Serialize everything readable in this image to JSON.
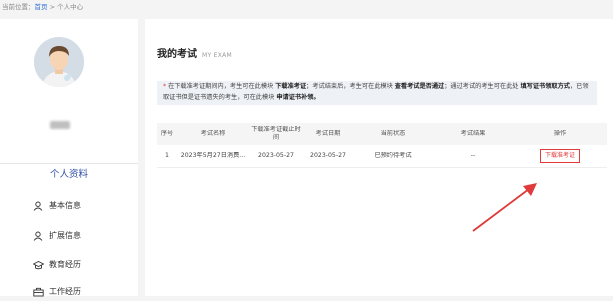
{
  "breadcrumb": {
    "prefix": "当前位置：",
    "home": "首页",
    "sep": " > ",
    "current": "个人中心"
  },
  "sidebar": {
    "section_title": "个人资料",
    "items": [
      {
        "label": "基本信息",
        "icon": "person-icon"
      },
      {
        "label": "扩展信息",
        "icon": "person-icon"
      },
      {
        "label": "教育经历",
        "icon": "graduation-cap-icon"
      },
      {
        "label": "工作经历",
        "icon": "briefcase-icon"
      }
    ]
  },
  "main": {
    "title": "我的考试",
    "title_sub": "MY EXAM",
    "notice": {
      "star": "*",
      "p1": "在下载准考证期间内，考生可在此模块 ",
      "b1": "下载准考证",
      "p2": "；考试结束后，考生可在此模块 ",
      "b2": "查看考试是否通过",
      "p3": "；通过考试的考生可在此处 ",
      "b3": "填写证书领取方式",
      "p4": "，已领取证书但是证书遗失的考生，可在此模块 ",
      "b4": "申请证书补领。"
    },
    "table": {
      "headers": [
        "序号",
        "考试名称",
        "下载准考证截止时间",
        "考试日期",
        "当前状态",
        "考试结果",
        "操作"
      ],
      "rows": [
        {
          "index": "1",
          "name": "2023年5月27日消费...",
          "deadline": "2023-05-27",
          "date": "2023-05-27",
          "status": "已预约待考试",
          "result": "--",
          "action": "下载准考证"
        }
      ]
    }
  },
  "colors": {
    "accent_red": "#e03a3a",
    "link_blue": "#2f6fd6",
    "section_blue": "#2f4fa8"
  }
}
